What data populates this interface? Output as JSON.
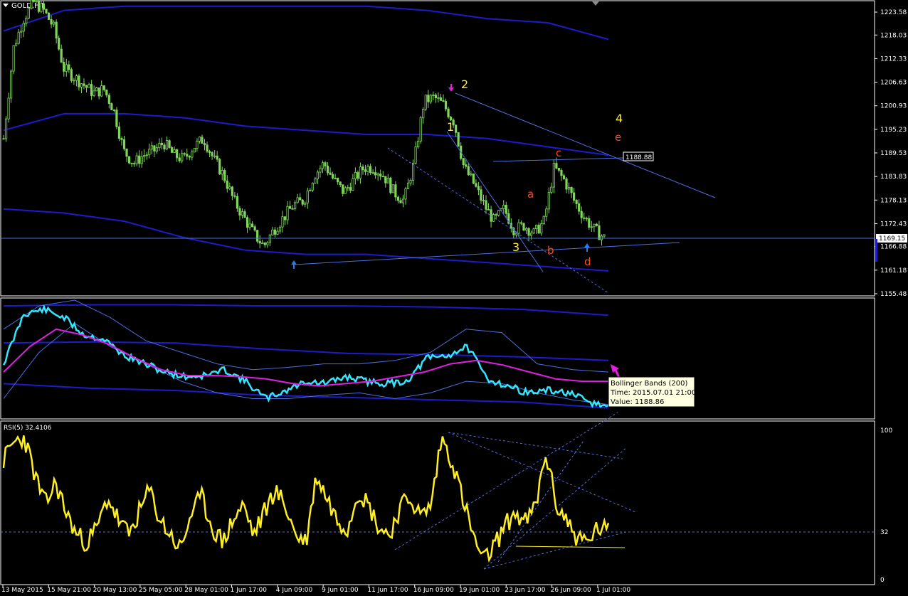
{
  "window": {
    "title": "GOLD,H4"
  },
  "colors": {
    "background": "#000000",
    "panel_border": "#ffffff",
    "candle": "#7fd75a",
    "bollinger": "#1c1ccc",
    "trendline": "#4a6fe0",
    "wave_yellow": "#ffee22",
    "wave_red": "#ff4a1c",
    "arrow_up": "#1f7fe6",
    "arrow_down": "#e020e0",
    "cyan_line": "#33e6ff",
    "magenta_ma": "#e020e0",
    "rsi_line": "#ffee22"
  },
  "chart_data": [
    {
      "type": "candlestick",
      "name": "main",
      "title": "GOLD,H4",
      "y_ticks": [
        "1223.58",
        "1218.03",
        "1212.33",
        "1206.63",
        "1200.93",
        "1195.23",
        "1189.53",
        "1183.83",
        "1178.13",
        "1172.43",
        "1166.88",
        "1161.18",
        "1155.48"
      ],
      "ylim": [
        1155.48,
        1223.58
      ],
      "price_line": "1169.15",
      "price_label_box": "1188.88",
      "series": [
        {
          "name": "close",
          "approx_values": [
            1193,
            1215,
            1222,
            1226,
            1224,
            1220,
            1210,
            1208,
            1206,
            1204,
            1205,
            1200,
            1190,
            1187,
            1189,
            1190,
            1192,
            1189,
            1188,
            1191,
            1193,
            1188,
            1184,
            1178,
            1174,
            1170,
            1167,
            1171,
            1174,
            1177,
            1178,
            1184,
            1187,
            1183,
            1180,
            1183,
            1186,
            1186,
            1184,
            1180,
            1178,
            1187,
            1202,
            1203,
            1201,
            1197,
            1186,
            1182,
            1177,
            1173,
            1176,
            1171,
            1172,
            1170,
            1173,
            1186,
            1183,
            1178,
            1174,
            1171,
            1169
          ]
        }
      ],
      "bands": {
        "upper": [
          1219,
          1224,
          1225,
          1225,
          1225,
          1225,
          1225,
          1224,
          1222,
          1221,
          1217
        ],
        "middle": [
          1195,
          1199,
          1199,
          1198,
          1196,
          1195,
          1194,
          1194,
          1193,
          1191,
          1189
        ],
        "lower": [
          1176,
          1175,
          1173,
          1169,
          1166,
          1165,
          1165,
          1164,
          1163,
          1162,
          1161
        ]
      },
      "annotations": [
        {
          "text": "1",
          "color": "yellow"
        },
        {
          "text": "2",
          "color": "yellow"
        },
        {
          "text": "3",
          "color": "yellow"
        },
        {
          "text": "4",
          "color": "yellow"
        },
        {
          "text": "a",
          "color": "red"
        },
        {
          "text": "b",
          "color": "red"
        },
        {
          "text": "c",
          "color": "red"
        },
        {
          "text": "d",
          "color": "red"
        },
        {
          "text": "e",
          "color": "red"
        }
      ]
    },
    {
      "type": "line",
      "name": "indicator",
      "title": "",
      "tooltip": {
        "line1": "Bollinger Bands (200)",
        "line2": "Time: 2015.07.01 21:00",
        "line3": "Value: 1188.86"
      },
      "series": [
        {
          "name": "cyan",
          "approx_values": [
            0.55,
            0.12,
            0.08,
            0.15,
            0.3,
            0.34,
            0.48,
            0.55,
            0.62,
            0.66,
            0.65,
            0.6,
            0.7,
            0.85,
            0.78,
            0.7,
            0.72,
            0.66,
            0.7,
            0.72,
            0.7,
            0.5,
            0.48,
            0.4,
            0.68,
            0.74,
            0.8,
            0.78,
            0.8,
            0.88,
            0.92
          ]
        },
        {
          "name": "magenta",
          "approx_values": [
            0.62,
            0.4,
            0.25,
            0.3,
            0.38,
            0.5,
            0.6,
            0.65,
            0.65,
            0.66,
            0.68,
            0.72,
            0.74,
            0.72,
            0.7,
            0.66,
            0.62,
            0.55,
            0.52,
            0.56,
            0.62,
            0.68,
            0.7,
            0.7
          ]
        }
      ]
    },
    {
      "type": "line",
      "name": "RSI(5)",
      "title": "RSI(5) 32.4106",
      "y_ticks": [
        "100",
        "32",
        "0"
      ],
      "ylim": [
        0,
        100
      ],
      "level": 32,
      "series": [
        {
          "name": "RSI(5)",
          "approx_values": [
            80,
            92,
            95,
            70,
            50,
            65,
            45,
            30,
            25,
            35,
            55,
            40,
            30,
            45,
            60,
            40,
            30,
            20,
            45,
            55,
            35,
            25,
            40,
            50,
            30,
            45,
            60,
            50,
            30,
            25,
            70,
            55,
            40,
            35,
            60,
            50,
            35,
            30,
            48,
            55,
            42,
            50,
            95,
            80,
            55,
            30,
            12,
            22,
            35,
            45,
            38,
            48,
            85,
            50,
            40,
            28,
            25,
            35,
            32
          ]
        }
      ]
    }
  ],
  "x_axis": {
    "labels": [
      "13 May 2015",
      "15 May 21:00",
      "20 May 13:00",
      "25 May 05:00",
      "28 May 01:00",
      "1 Jun 17:00",
      "4 Jun 09:00",
      "9 Jun 01:00",
      "11 Jun 17:00",
      "16 Jun 09:00",
      "19 Jun 01:00",
      "23 Jun 17:00",
      "26 Jun 09:00",
      "1 Jul 01:00"
    ]
  }
}
